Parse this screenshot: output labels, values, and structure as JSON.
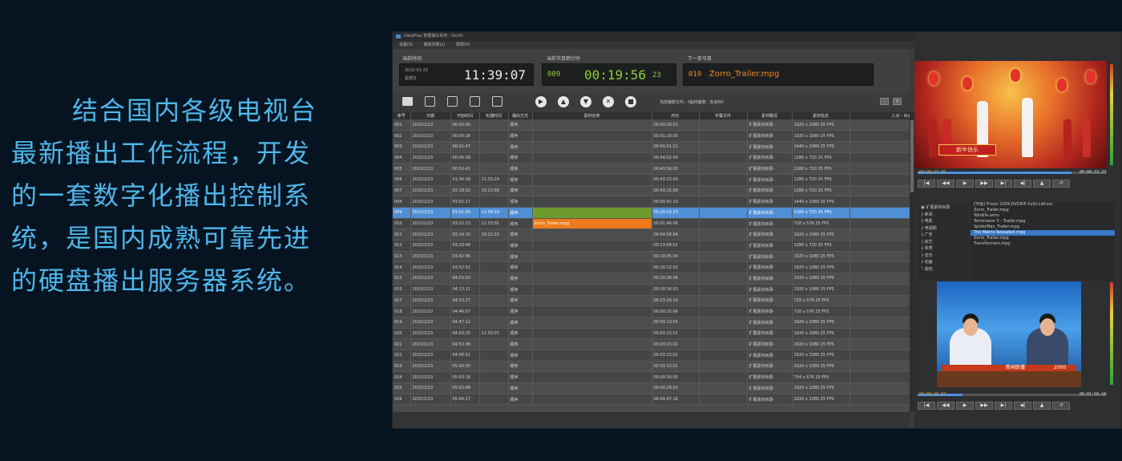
{
  "promo": {
    "lines": [
      "结合国内各级电视台",
      "最新播出工作流程，开发",
      "的一套数字化播出控制系",
      "统，是国内成熟可靠先进",
      "的硬盘播出服务器系统。"
    ]
  },
  "app": {
    "title": "IdealPlay 数据播出系统 - Smith",
    "menu": [
      "设置(S)",
      "播放列表(L)",
      "帮助(H)"
    ],
    "current_time": {
      "label": "当前时间",
      "date": "2015-01-23",
      "weekday": "星期五",
      "time": "11:39:07"
    },
    "countdown": {
      "label": "当前节目倒计时",
      "index": "009",
      "time": "00:19:56",
      "frame": "23"
    },
    "next_program": {
      "label": "下一条节目",
      "index": "010",
      "name": "Zorro_Trailer.mpg"
    },
    "toolbar_note": "当前播表文件：《临时播表：本身存》",
    "columns": [
      "序号",
      "日期",
      "开始时间",
      "实播时间",
      "播出方式",
      "素材名称",
      "时长",
      "字幕文件",
      "素材路径",
      "素材信息",
      "入点 - 出点"
    ],
    "rows": [
      [
        "001",
        "2015/1/23",
        "00:00:00",
        "",
        "顺序",
        "",
        "00:00:28.02",
        "",
        "扩展素材目录-",
        "1920 x 1080 25 FPS",
        ""
      ],
      [
        "002",
        "2015/1/23",
        "00:00:28",
        "",
        "顺序",
        "",
        "00:01:19.05",
        "",
        "扩展素材目录-",
        "1920 x 1080 25 FPS",
        ""
      ],
      [
        "003",
        "2015/1/23",
        "00:01:47",
        "",
        "顺序",
        "",
        "00:04:51.21",
        "",
        "扩展素材目录-",
        "1440 x 1080 25 FPS",
        ""
      ],
      [
        "004",
        "2015/1/23",
        "00:06:39",
        "",
        "顺序",
        "",
        "00:44:02.00",
        "",
        "扩展素材目录-",
        "1280 x 720 25 FPS",
        ""
      ],
      [
        "005",
        "2015/1/23",
        "00:50:41",
        "",
        "顺序",
        "",
        "00:43:58.00",
        "",
        "扩展素材目录-",
        "1280 x 720 25 FPS",
        ""
      ],
      [
        "006",
        "2015/1/23",
        "01:34:39",
        "11:33:24",
        "顺序",
        "",
        "00:43:23.00",
        "",
        "扩展素材目录-",
        "1280 x 720 25 FPS",
        ""
      ],
      [
        "007",
        "2015/1/23",
        "02:18:02",
        "10:23:58",
        "顺序",
        "",
        "00:43:15.00",
        "",
        "扩展素材目录-",
        "1280 x 720 25 FPS",
        ""
      ],
      [
        "008",
        "2015/1/23",
        "03:01:17",
        "",
        "顺序",
        "",
        "00:00:42.19",
        "",
        "扩展素材目录-",
        "1440 x 1080 25 FPS",
        ""
      ],
      [
        "009",
        "2015/1/23",
        "03:01:59",
        "11:58:10",
        "顺序",
        "",
        "00:20:23.23",
        "",
        "扩展素材目录-",
        "1280 x 720 25 FPS",
        ""
      ],
      [
        "010",
        "2015/1/23",
        "03:22:23",
        "11:33:01",
        "顺序",
        "Zorro_Trailer.mpg",
        "00:01:46.06",
        "",
        "扩展素材目录-",
        "720 x 576 25 FPS",
        ""
      ],
      [
        "011",
        "2015/1/23",
        "03:24:10",
        "10:22:33",
        "顺序",
        "",
        "00:04:58.04",
        "",
        "扩展素材目录-",
        "1920 x 1080 25 FPS",
        ""
      ],
      [
        "012",
        "2015/1/23",
        "03:29:48",
        "",
        "顺序",
        "",
        "00:13:58.01",
        "",
        "扩展素材目录-",
        "1280 x 720 25 FPS",
        ""
      ],
      [
        "013",
        "2015/1/23",
        "03:42:46",
        "",
        "顺序",
        "",
        "00:10:05.04",
        "",
        "扩展素材目录-",
        "1920 x 1080 25 FPS",
        ""
      ],
      [
        "014",
        "2015/1/23",
        "03:52:51",
        "",
        "顺序",
        "",
        "00:10:12.02",
        "",
        "扩展素材目录-",
        "1920 x 1080 25 FPS",
        ""
      ],
      [
        "015",
        "2015/1/23",
        "04:03:03",
        "",
        "顺序",
        "",
        "00:10:08.06",
        "",
        "扩展素材目录-",
        "1920 x 1080 25 FPS",
        ""
      ],
      [
        "016",
        "2015/1/23",
        "04:13:11",
        "",
        "顺序",
        "",
        "00:10:16.03",
        "",
        "扩展素材目录-",
        "1920 x 1080 25 FPS",
        ""
      ],
      [
        "017",
        "2015/1/23",
        "04:23:27",
        "",
        "顺序",
        "",
        "00:23:29.19",
        "",
        "扩展素材目录-",
        "720 x 576 25 FPS",
        ""
      ],
      [
        "018",
        "2015/1/23",
        "04:46:57",
        "",
        "顺序",
        "",
        "00:00:15.06",
        "",
        "扩展素材目录-",
        "720 x 576 25 FPS",
        ""
      ],
      [
        "019",
        "2015/1/23",
        "04:47:12",
        "",
        "顺序",
        "",
        "00:03:13.01",
        "",
        "扩展素材目录-",
        "1920 x 1080 25 FPS",
        ""
      ],
      [
        "020",
        "2015/1/23",
        "04:50:25",
        "11:33:07",
        "顺序",
        "",
        "00:03:13.01",
        "",
        "扩展素材目录-",
        "1920 x 1080 25 FPS",
        ""
      ],
      [
        "021",
        "2015/1/23",
        "04:53:38",
        "",
        "顺序",
        "",
        "00:03:13.01",
        "",
        "扩展素材目录-",
        "1920 x 1080 25 FPS",
        ""
      ],
      [
        "022",
        "2015/1/23",
        "04:56:51",
        "",
        "顺序",
        "",
        "00:03:13.01",
        "",
        "扩展素材目录-",
        "1920 x 1080 25 FPS",
        ""
      ],
      [
        "023",
        "2015/1/23",
        "05:00:05",
        "",
        "顺序",
        "",
        "00:03:13.01",
        "",
        "扩展素材目录-",
        "1920 x 1080 25 FPS",
        ""
      ],
      [
        "024",
        "2015/1/23",
        "05:03:18",
        "",
        "顺序",
        "",
        "00:00:30.05",
        "",
        "扩展素材目录-",
        "704 x 576 25 FPS",
        ""
      ],
      [
        "025",
        "2015/1/23",
        "05:03:48",
        "",
        "顺序",
        "",
        "00:00:29.03",
        "",
        "扩展素材目录-",
        "1920 x 1080 25 FPS",
        ""
      ],
      [
        "026",
        "2015/1/23",
        "05:04:17",
        "",
        "顺序",
        "",
        "00:04:07.18",
        "",
        "扩展素材目录-",
        "1920 x 1080 25 FPS",
        ""
      ]
    ],
    "selected_row_index": 8,
    "next_row_index": 9,
    "preview": {
      "top_timecode": "00:00:27.05",
      "top_duration": "00:00:33.23",
      "banner_text": "新年快乐",
      "bottom_timecode": "00:00:26.07",
      "bottom_duration": "00:01:50.10",
      "channel_logo_text": "新闻联播",
      "ticker_time": "2000"
    },
    "files": [
      "[可视] Prison 2009.DVDRIP XviD-LAP.avi",
      "Zorro_Trailer.mpg",
      "Wildlife.wmv",
      "Terminator 3 - Trailer.mpg",
      "SpiderMan_Trailer.mpg",
      "The Matrix Reloaded.mpg",
      "Zorro_Trailer.mpg",
      "Transformers.mpg"
    ],
    "selected_file_index": 5,
    "colors": {
      "selected_row": "#4f8fd4",
      "next_row": "#ee7a1c",
      "countdown": "#8ed13a",
      "accent_text": "#4fb6ea"
    }
  }
}
